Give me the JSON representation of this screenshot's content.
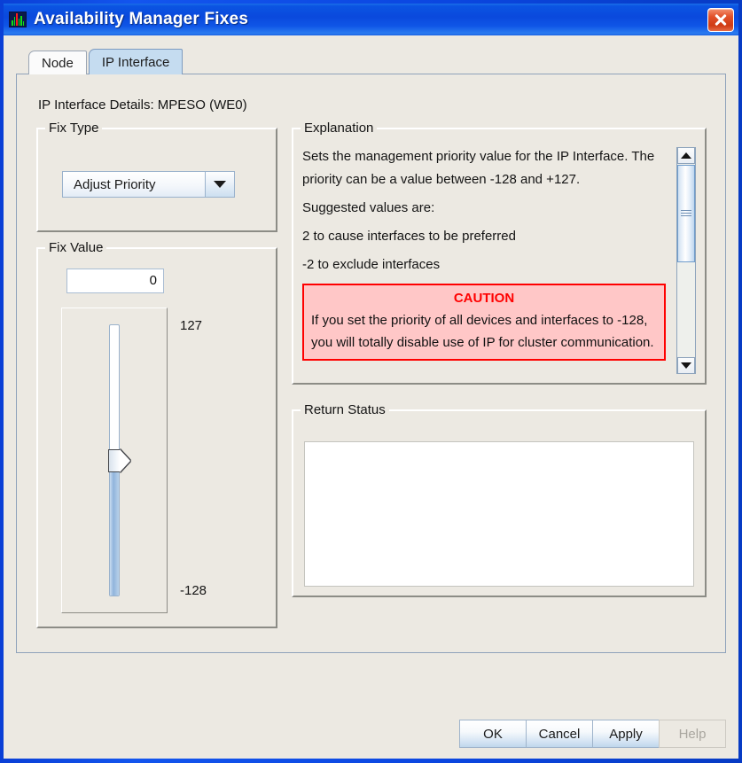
{
  "window": {
    "title": "Availability Manager Fixes",
    "icon": "bar-chart-icon",
    "close_label": "×",
    "titlebar_color": "#0b4ae0",
    "client_color": "#ece9e2"
  },
  "tabs": [
    {
      "label": "Node",
      "selected": false
    },
    {
      "label": "IP Interface",
      "selected": true
    }
  ],
  "details": {
    "line": "IP Interface Details: MPESO  (WE0)"
  },
  "fix_type": {
    "group_label": "Fix Type",
    "selected_option": "Adjust Priority",
    "options": [
      "Adjust Priority"
    ]
  },
  "fix_value": {
    "group_label": "Fix Value",
    "value": "0",
    "slider_max_label": "127",
    "slider_min_label": "-128",
    "slider_value": 0,
    "slider_min": -128,
    "slider_max": 127
  },
  "explanation": {
    "group_label": "Explanation",
    "paragraph1": "Sets the management priority value for the IP Interface. The priority can be a value between -128 and +127.",
    "paragraph2": "Suggested values are:",
    "bullet1": "2 to cause interfaces to be preferred",
    "bullet2": "-2 to exclude interfaces",
    "caution_title": "CAUTION",
    "caution_text": "If you set the priority of all devices and interfaces to -128, you will totally disable use of IP for cluster communication.",
    "caution_border_color": "#ff0000",
    "caution_bg_color": "#ffc7c7"
  },
  "return_status": {
    "group_label": "Return Status",
    "value": ""
  },
  "buttons": [
    {
      "label": "OK",
      "enabled": true
    },
    {
      "label": "Cancel",
      "enabled": true
    },
    {
      "label": "Apply",
      "enabled": true
    },
    {
      "label": "Help",
      "enabled": false
    }
  ]
}
